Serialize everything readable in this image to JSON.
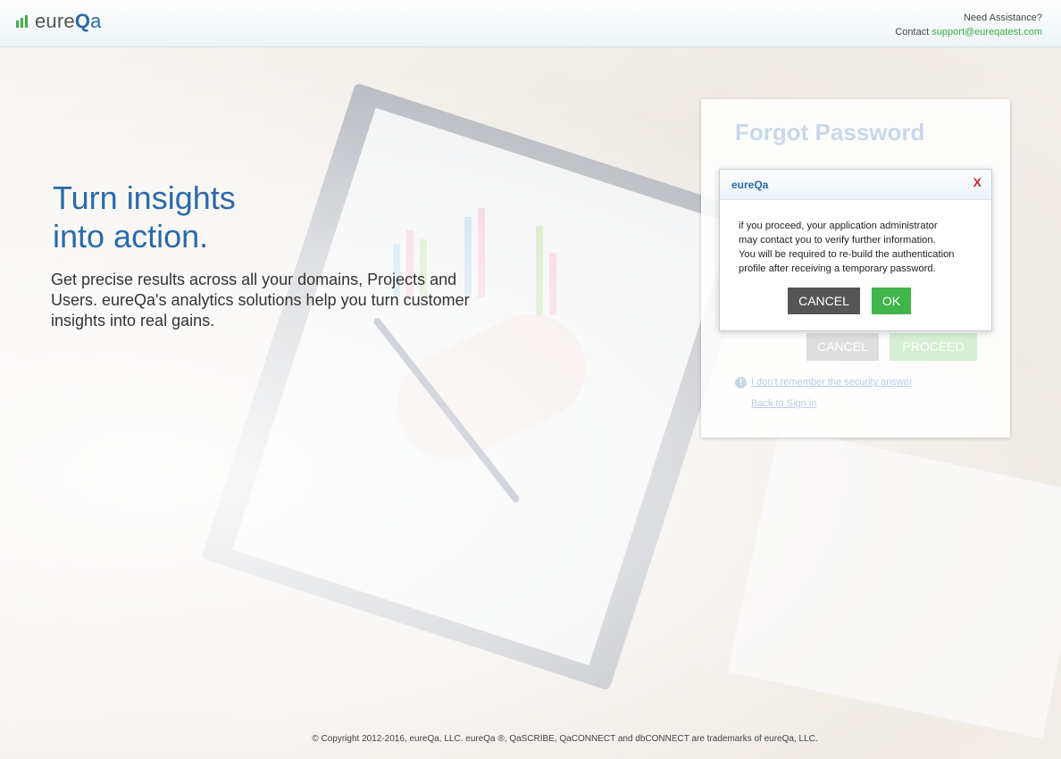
{
  "header": {
    "logo_text_pre": "eure",
    "logo_text_q": "Q",
    "logo_text_a": "a",
    "need_assistance": "Need Assistance?",
    "contact_label": "Contact",
    "support_email": "support@eureqatest.com"
  },
  "hero": {
    "title_line1": "Turn insights",
    "title_line2": "into action.",
    "text_line1": "Get precise results across all your domains, Projects and",
    "text_line2": "Users. eureQa's analytics solutions help you turn customer",
    "text_line3": "insights into real gains."
  },
  "forgot_card": {
    "title": "Forgot Password",
    "cancel_label": "CANCEL",
    "proceed_label": "PROCEED",
    "info_icon_glyph": "!",
    "security_link": "I don't remember the security answer",
    "back_link": "Back to Sign in"
  },
  "modal": {
    "title": "eureQa",
    "close_label": "X",
    "line1": "if you proceed, your application administrator",
    "line2": "may contact you to verify further information.",
    "line3": "You will be required to re-build the authentication",
    "line4": "profile after receiving a temporary password.",
    "cancel_label": "CANCEL",
    "ok_label": "OK"
  },
  "footer": {
    "copyright": "© Copyright 2012-2016, eureQa, LLC. eureQa ®, QaSCRIBE, QaCONNECT and dbCONNECT are trademarks of eureQa, LLC."
  },
  "colors": {
    "brand_blue": "#2a6aab",
    "brand_green": "#3fae49",
    "close_red": "#d9262f"
  }
}
